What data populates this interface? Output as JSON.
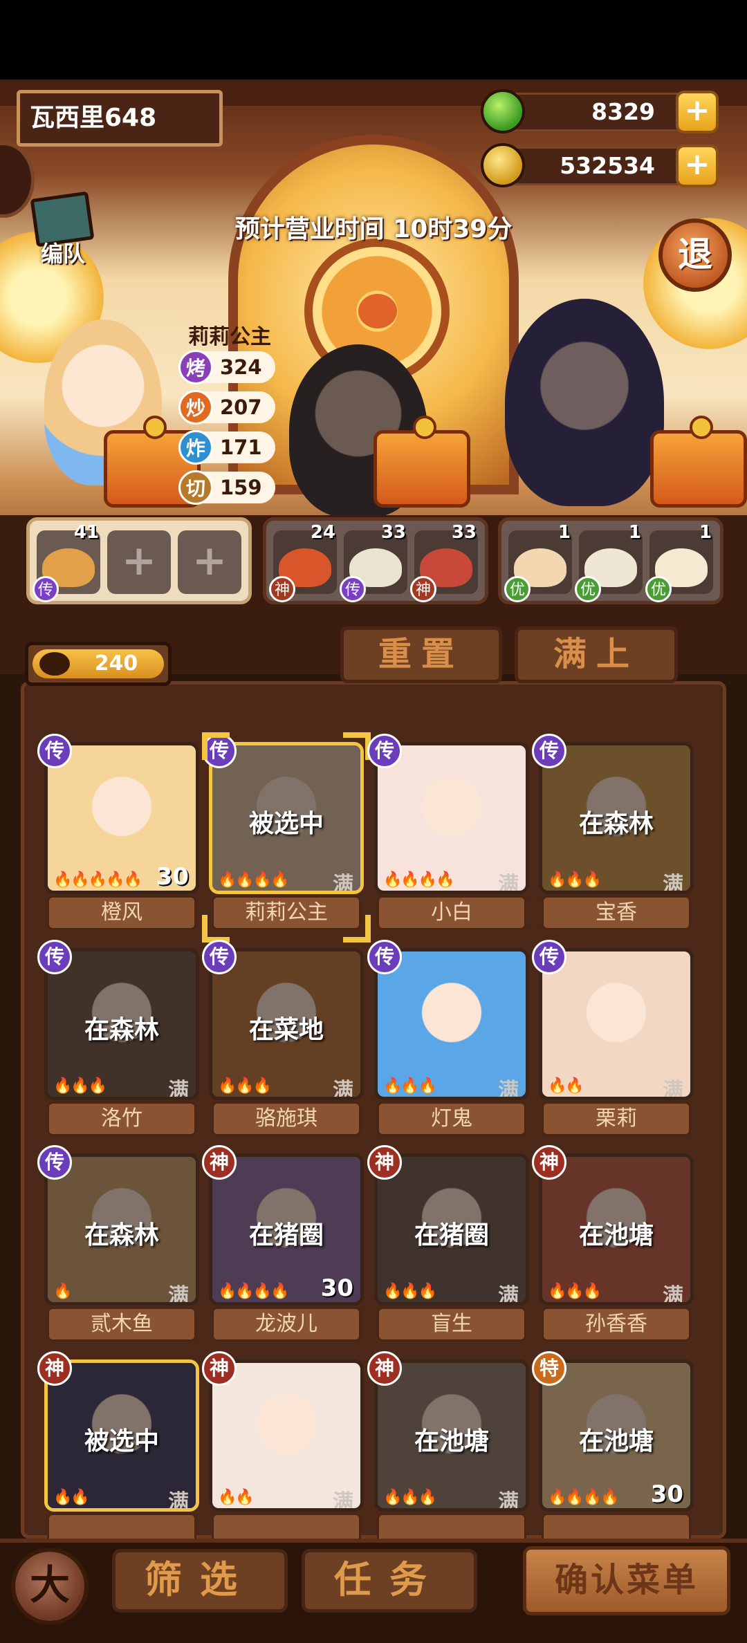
{
  "header": {
    "player_name": "瓦西里648",
    "gems": "8329",
    "coins": "532534",
    "plus_label": "+",
    "formation_label": "编队",
    "business_time": "预计营业时间  10时39分",
    "exit_label": "退"
  },
  "chef": {
    "name": "莉莉公主",
    "stats": [
      {
        "badge": "烤",
        "value": "324"
      },
      {
        "badge": "炒",
        "value": "207"
      },
      {
        "badge": "炸",
        "value": "171"
      },
      {
        "badge": "切",
        "value": "159"
      }
    ]
  },
  "dish_groups": [
    {
      "slots": [
        {
          "count": "41",
          "grade": "传"
        },
        {
          "plus": "+"
        },
        {
          "plus": "+"
        }
      ]
    },
    {
      "slots": [
        {
          "count": "24",
          "grade": "神"
        },
        {
          "count": "33",
          "grade": "传"
        },
        {
          "count": "33",
          "grade": "神"
        }
      ]
    },
    {
      "slots": [
        {
          "count": "1",
          "grade": "优"
        },
        {
          "count": "1",
          "grade": "优"
        },
        {
          "count": "1",
          "grade": "优"
        }
      ]
    }
  ],
  "controls": {
    "counter_value": "240",
    "reset_label": "重置",
    "fill_label": "满上"
  },
  "cards": [
    {
      "name": "橙风",
      "rank": "传",
      "status": "",
      "flames": "🔥🔥🔥🔥🔥",
      "level": "30",
      "full": ""
    },
    {
      "name": "莉莉公主",
      "rank": "传",
      "status": "被选中",
      "flames": "🔥🔥🔥🔥",
      "level": "",
      "full": "满"
    },
    {
      "name": "小白",
      "rank": "传",
      "status": "",
      "flames": "🔥🔥🔥🔥",
      "level": "",
      "full": "满"
    },
    {
      "name": "宝香",
      "rank": "传",
      "status": "在森林",
      "flames": "🔥🔥🔥",
      "level": "",
      "full": "满"
    },
    {
      "name": "洛竹",
      "rank": "传",
      "status": "在森林",
      "flames": "🔥🔥🔥",
      "level": "",
      "full": "满"
    },
    {
      "name": "骆施琪",
      "rank": "传",
      "status": "在菜地",
      "flames": "🔥🔥🔥",
      "level": "",
      "full": "满"
    },
    {
      "name": "灯鬼",
      "rank": "传",
      "status": "",
      "flames": "🔥🔥🔥",
      "level": "",
      "full": "满"
    },
    {
      "name": "栗莉",
      "rank": "传",
      "status": "",
      "flames": "🔥🔥",
      "level": "",
      "full": "满"
    },
    {
      "name": "贰木鱼",
      "rank": "传",
      "status": "在森林",
      "flames": "🔥",
      "level": "",
      "full": "满"
    },
    {
      "name": "龙波儿",
      "rank": "神",
      "status": "在猪圈",
      "flames": "🔥🔥🔥🔥",
      "level": "30",
      "full": ""
    },
    {
      "name": "盲生",
      "rank": "神",
      "status": "在猪圈",
      "flames": "🔥🔥🔥",
      "level": "",
      "full": "满"
    },
    {
      "name": "孙香香",
      "rank": "神",
      "status": "在池塘",
      "flames": "🔥🔥🔥",
      "level": "",
      "full": "满"
    },
    {
      "name": "",
      "rank": "神",
      "status": "被选中",
      "flames": "🔥🔥",
      "level": "",
      "full": "满"
    },
    {
      "name": "",
      "rank": "神",
      "status": "",
      "flames": "🔥🔥",
      "level": "",
      "full": "满"
    },
    {
      "name": "",
      "rank": "神",
      "status": "在池塘",
      "flames": "🔥🔥🔥",
      "level": "",
      "full": "满"
    },
    {
      "name": "",
      "rank": "特",
      "status": "在池塘",
      "flames": "🔥🔥🔥🔥",
      "level": "30",
      "full": ""
    }
  ],
  "bottom_nav": {
    "kitchen_glyph": "大",
    "filter_label": "筛选",
    "task_label": "任务",
    "confirm_label": "确认菜单"
  },
  "colors": {
    "card_bg": [
      "#f6d59a",
      "#d8c2a4",
      "#f7e3dc",
      "#c99a4c",
      "#6a5648",
      "#b8733c",
      "#5aa6e6",
      "#f2d8c2",
      "#c9a36a",
      "#8a6aa6",
      "#6c5a50",
      "#c25c4a",
      "#3c3f66",
      "#f4e6dc",
      "#8a7a6e",
      "#e6c896"
    ]
  }
}
